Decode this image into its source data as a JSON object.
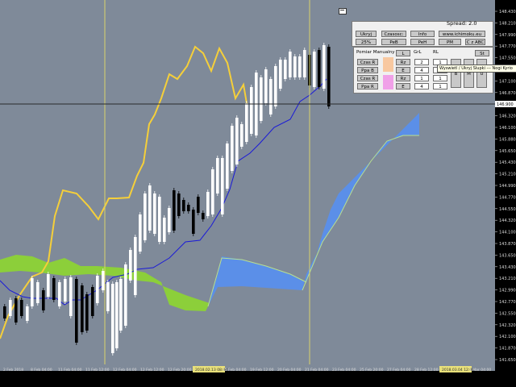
{
  "chart_data": {
    "type": "ohlc-ichimoku",
    "x_ticks": [
      "2 Feb 2018",
      "8 Feb 04:00",
      "11 Feb 04:00",
      "11 Feb 12:00",
      "12 Feb 04:00",
      "12 Feb 12:00",
      "12 Feb 20:00",
      "2018.02.13 08:00",
      "15 Feb 04:00",
      "19 Feb 12:00",
      "20 Feb 04:00",
      "21 Feb 04:00",
      "23 Feb 04:00",
      "25 Feb 20:00",
      "27 Feb 04:00",
      "28 Feb 12:00",
      "2018.03.04 12:00",
      "1 Mar 04:00"
    ],
    "y_ticks": [
      "148.430",
      "148.210",
      "147.990",
      "147.770",
      "147.550",
      "147.330",
      "147.100",
      "146.870",
      "146.550",
      "146.320",
      "146.100",
      "145.880",
      "145.650",
      "145.430",
      "145.210",
      "144.990",
      "144.770",
      "144.550",
      "144.320",
      "144.100",
      "143.870",
      "143.650",
      "143.430",
      "143.210",
      "142.990",
      "142.770",
      "142.550",
      "142.320",
      "142.100",
      "141.870",
      "141.650"
    ],
    "current_price": "146.900",
    "highlight_labels": [
      "2018.02.13 08:00",
      "2018.03.04 12:00"
    ],
    "series": [
      {
        "name": "chikou",
        "color": "#f5cf3a"
      },
      {
        "name": "kijun",
        "color": "#1a1ad8"
      },
      {
        "name": "senkou_bullish",
        "color": "#8ccf3a"
      },
      {
        "name": "senkou_bearish",
        "color": "#5b8fe8"
      }
    ],
    "candles_up_color": "#ffffff",
    "candles_down_color": "#000000"
  },
  "panel": {
    "spread": "Spread: 2.0",
    "buttons": [
      "Ukryj",
      "Czasosc: 3",
      "Info",
      "www.ichimoku.eu",
      "25%",
      "PeB",
      "PeH",
      "PM",
      "C z ABC"
    ],
    "manual_title": "Pomiar Manualny",
    "col_L": "L",
    "col_GrL": "GrL",
    "col_RL": "RL",
    "col_S": "St",
    "rows": [
      {
        "btn": "Czas R",
        "mid": "Rz",
        "v1": "2",
        "v2": "1"
      },
      {
        "btn": "Ppa B",
        "mid": "E",
        "v1": "4",
        "v2": "1"
      },
      {
        "btn": "Czas R",
        "mid": "Rz",
        "v1": "1",
        "v2": "1"
      },
      {
        "btn": "Ppa R",
        "mid": "E",
        "v1": "4",
        "v2": "1"
      }
    ],
    "small_buttons": [
      "B",
      "M",
      "U"
    ],
    "tooltip": "Wyswietl / Ukryj Slupki --- Nogi Kyrio",
    "swatch_colors": [
      "#f8c8a0",
      "#f0a0e8"
    ],
    "corner_icon": "window-icon"
  }
}
